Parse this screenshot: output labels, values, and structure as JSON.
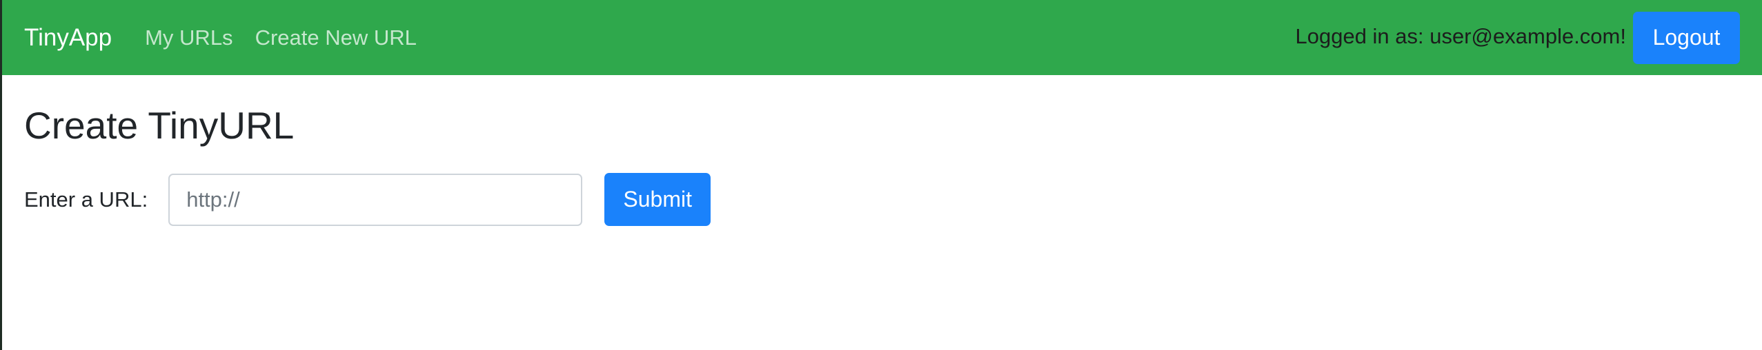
{
  "navbar": {
    "brand": "TinyApp",
    "links": [
      {
        "label": "My URLs"
      },
      {
        "label": "Create New URL"
      }
    ],
    "logged_in_text": "Logged in as: user@example.com!",
    "logout_label": "Logout"
  },
  "main": {
    "title": "Create TinyURL",
    "form": {
      "url_label": "Enter a URL:",
      "url_placeholder": "http://",
      "url_value": "",
      "submit_label": "Submit"
    }
  },
  "colors": {
    "navbar_bg": "#2fa84c",
    "primary_button": "#1a82fb"
  }
}
